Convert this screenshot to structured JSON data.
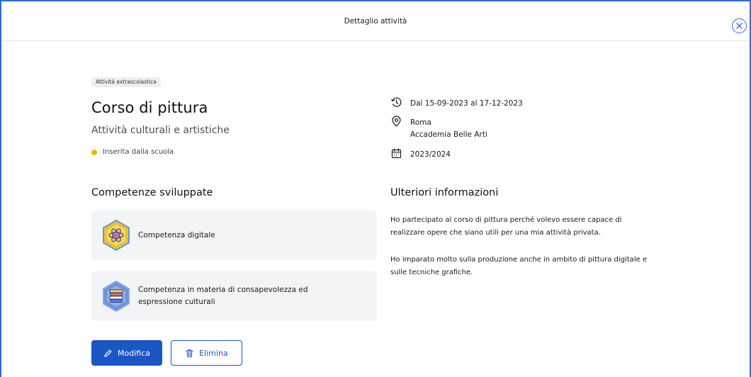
{
  "header": {
    "title": "Dettaglio attività"
  },
  "activity": {
    "tag": "Attività extrascolastica",
    "title": "Corso di pittura",
    "subtitle": "Attività culturali e artistiche",
    "status": "Inserita dalla scuola",
    "status_color": "#f2b705"
  },
  "info": {
    "dates": "Dal 15-09-2023 al 17-12-2023",
    "city": "Roma",
    "place": "Accademia Belle Arti",
    "year": "2023/2024"
  },
  "skills": {
    "heading": "Competenze sviluppate",
    "items": [
      {
        "label": "Competenza digitale",
        "icon": "atom-badge-icon"
      },
      {
        "label_line1": "Competenza in materia di consapevolezza ed",
        "label_line2": "espressione culturali",
        "icon": "books-badge-icon"
      }
    ]
  },
  "more": {
    "heading": "Ulteriori informazioni",
    "p1_line1": "Ho partecipato al corso di pittura perché volevo essere capace di",
    "p1_line2": "realizzare opere che siano utili per una mia attività privata.",
    "p2_line1": "Ho imparato molto sulla produzione anche in ambito di pittura digitale e",
    "p2_line2": "sulle tecniche grafiche."
  },
  "actions": {
    "edit": "Modifica",
    "delete": "Elimina"
  },
  "colors": {
    "primary": "#1a56c4",
    "frame": "#2f6bd8",
    "card": "#f3f4f6"
  }
}
